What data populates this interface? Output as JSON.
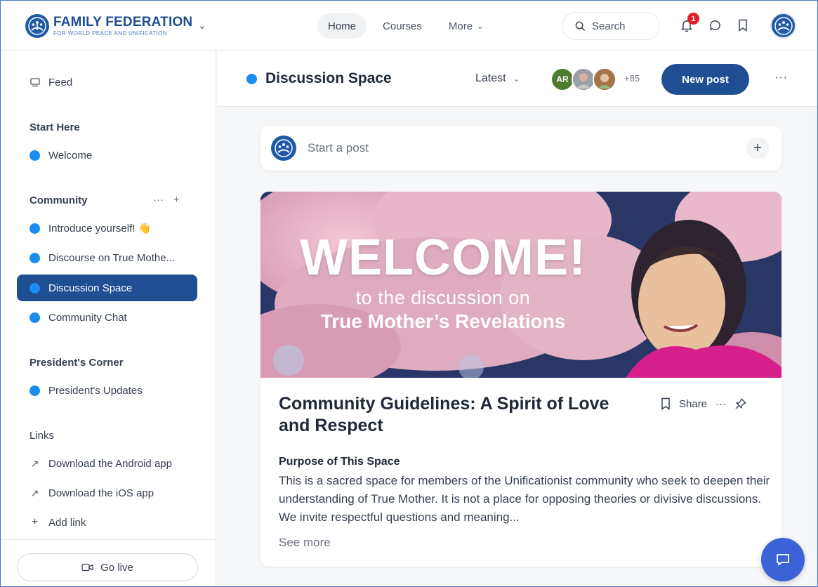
{
  "brand": {
    "name": "FAMILY FEDERATION",
    "subtitle": "FOR WORLD PEACE AND UNIFICATION"
  },
  "topnav": {
    "items": [
      {
        "label": "Home"
      },
      {
        "label": "Courses"
      },
      {
        "label": "More"
      }
    ],
    "active": "Home",
    "search_label": "Search",
    "notification_count": "1"
  },
  "sidebar": {
    "feed_label": "Feed",
    "start_here": {
      "heading": "Start Here",
      "items": [
        {
          "label": "Welcome"
        }
      ]
    },
    "community": {
      "heading": "Community",
      "items": [
        {
          "label": "Introduce yourself! 👋"
        },
        {
          "label": "Discourse on True Mothe..."
        },
        {
          "label": "Discussion Space"
        },
        {
          "label": "Community Chat"
        }
      ],
      "active": "Discussion Space"
    },
    "presidents_corner": {
      "heading": "President's Corner",
      "items": [
        {
          "label": "President's Updates"
        }
      ]
    },
    "links": {
      "heading": "Links",
      "items": [
        {
          "label": "Download the Android app"
        },
        {
          "label": "Download the iOS app"
        },
        {
          "label": "Add link"
        }
      ]
    },
    "go_live_label": "Go live"
  },
  "space": {
    "title": "Discussion Space",
    "sort_label": "Latest",
    "member_initials": "AR",
    "member_count": "+85",
    "new_post_label": "New post"
  },
  "composer": {
    "placeholder": "Start a post"
  },
  "post": {
    "banner": {
      "headline": "WELCOME!",
      "line1": "to the discussion on",
      "line2": "True Mother’s Revelations"
    },
    "title": "Community Guidelines: A Spirit of Love and Respect",
    "share_label": "Share",
    "subheading": "Purpose of This Space",
    "body": "This is a sacred space for members of the Unificationist community who seek to deepen their understanding of True Mother. It is not a place for opposing theories or divisive discussions. We invite respectful questions and meaning...",
    "see_more": "See more"
  },
  "colors": {
    "primary": "#1f4e93",
    "accent_dot": "#1a8cf0",
    "notification": "#e11d2a",
    "chat_fab": "#3b62d6"
  },
  "icons": {
    "logo": "family-federation-logo",
    "feed": "monitor-icon",
    "search": "search-icon",
    "bell": "bell-icon",
    "chat": "chat-bubble-icon",
    "bookmark": "bookmark-icon",
    "pin": "pin-icon",
    "video": "video-camera-icon"
  }
}
